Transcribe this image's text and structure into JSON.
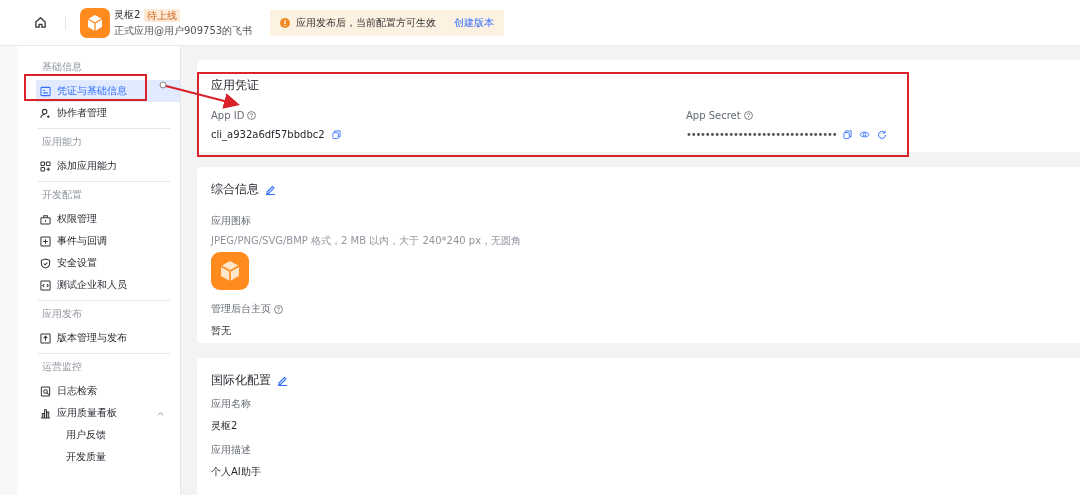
{
  "header": {
    "app_name": "灵枢2",
    "badge": "待上线",
    "subtitle": "正式应用@用户909753的飞书",
    "notice": "应用发布后，当前配置方可生效",
    "notice_link": "创建版本"
  },
  "sidebar": {
    "groups": [
      {
        "title": "基础信息",
        "items": [
          {
            "label": "凭证与基础信息",
            "kind": "card",
            "selected": true
          },
          {
            "label": "协作者管理",
            "kind": "user",
            "selected": false
          }
        ]
      },
      {
        "title": "应用能力",
        "items": [
          {
            "label": "添加应用能力",
            "kind": "grid",
            "selected": false
          }
        ]
      },
      {
        "title": "开发配置",
        "items": [
          {
            "label": "权限管理",
            "kind": "lock",
            "selected": false
          },
          {
            "label": "事件与回调",
            "kind": "plus",
            "selected": false
          },
          {
            "label": "安全设置",
            "kind": "shield",
            "selected": false
          },
          {
            "label": "测试企业和人员",
            "kind": "code",
            "selected": false
          }
        ]
      },
      {
        "title": "应用发布",
        "items": [
          {
            "label": "版本管理与发布",
            "kind": "upload",
            "selected": false
          }
        ]
      },
      {
        "title": "运营监控",
        "items": [
          {
            "label": "日志检索",
            "kind": "log",
            "selected": false
          },
          {
            "label": "应用质量看板",
            "kind": "chart",
            "selected": false,
            "expanded": true,
            "children": [
              {
                "label": "用户反馈",
                "selected": false
              },
              {
                "label": "开发质量",
                "selected": false
              }
            ]
          }
        ]
      }
    ]
  },
  "credentials": {
    "title": "应用凭证",
    "fields": [
      {
        "label": "App ID",
        "value": "cli_a932a6df57bbdbc2",
        "kind": "id"
      },
      {
        "label": "App Secret",
        "value": "••••••••••••••••••••••••••••••••",
        "kind": "secret"
      }
    ]
  },
  "general": {
    "title": "综合信息",
    "icon_label": "应用图标",
    "icon_hint": "JPEG/PNG/SVG/BMP 格式，2 MB 以内，大于 240*240 px，无圆角",
    "homepage_label": "管理后台主页",
    "homepage_value": "暂无"
  },
  "i18n": {
    "title": "国际化配置",
    "fields": [
      {
        "label": "应用名称",
        "value": "灵枢2"
      },
      {
        "label": "应用描述",
        "value": "个人AI助手"
      }
    ]
  }
}
